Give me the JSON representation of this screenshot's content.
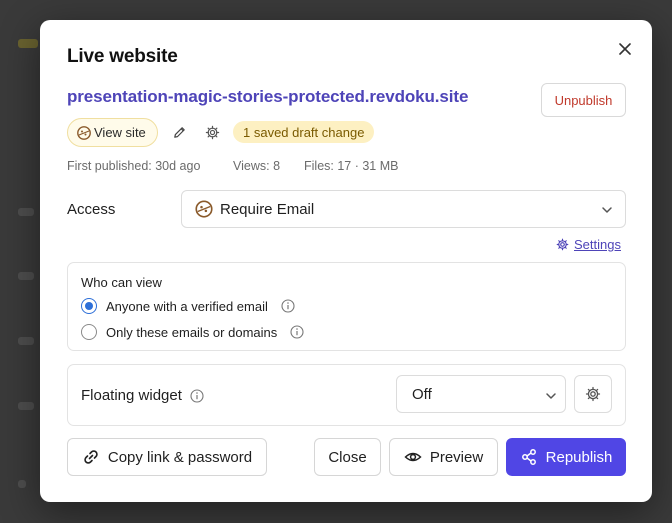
{
  "dialog": {
    "title": "Live website",
    "domain": "presentation-magic-stories-protected.revdoku.site",
    "unpublish_label": "Unpublish",
    "view_site_label": "View site",
    "draft_badge": "1 saved draft change",
    "meta": {
      "first_published": "First published: 30d ago",
      "views": "Views: 8",
      "files": "Files: 17 · 31 MB"
    },
    "access": {
      "label": "Access",
      "value": "Require Email"
    },
    "settings_link": "Settings",
    "who_can_view": {
      "title": "Who can view",
      "options": [
        {
          "label": "Anyone with a verified email",
          "checked": true
        },
        {
          "label": "Only these emails or domains",
          "checked": false
        }
      ]
    },
    "floating_widget": {
      "label": "Floating widget",
      "value": "Off"
    },
    "buttons": {
      "copy_link": "Copy link & password",
      "close": "Close",
      "preview": "Preview",
      "republish": "Republish"
    }
  },
  "colors": {
    "accent": "#5046e5",
    "link": "#4e44b8",
    "danger": "#c0392b",
    "badge_bg": "#fdf0c2",
    "radio": "#2d6fd8"
  }
}
